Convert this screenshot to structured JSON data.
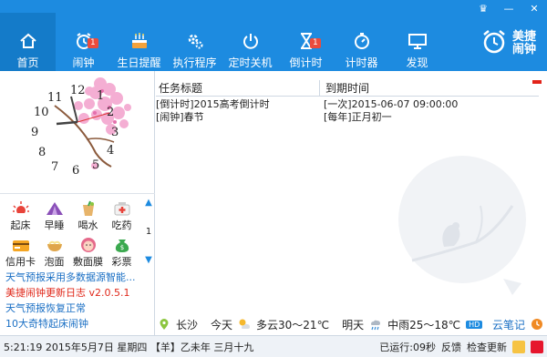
{
  "window": {
    "minimize_label": "—",
    "close_label": "✕",
    "skin_label": "♛"
  },
  "nav": [
    {
      "label": "首页",
      "icon": "home-icon",
      "active": true,
      "badge": ""
    },
    {
      "label": "闹钟",
      "icon": "alarm-icon",
      "active": false,
      "badge": "1"
    },
    {
      "label": "生日提醒",
      "icon": "cake-icon",
      "active": false,
      "badge": ""
    },
    {
      "label": "执行程序",
      "icon": "gears-icon",
      "active": false,
      "badge": ""
    },
    {
      "label": "定时关机",
      "icon": "power-icon",
      "active": false,
      "badge": ""
    },
    {
      "label": "倒计时",
      "icon": "hourglass-icon",
      "active": false,
      "badge": "1"
    },
    {
      "label": "计时器",
      "icon": "stopwatch-icon",
      "active": false,
      "badge": ""
    },
    {
      "label": "发现",
      "icon": "monitor-icon",
      "active": false,
      "badge": ""
    }
  ],
  "brand": {
    "line1": "美捷",
    "line2": "闹钟"
  },
  "clock": {
    "numbers": [
      "12",
      "1",
      "2",
      "3",
      "4",
      "5",
      "6",
      "7",
      "8",
      "9",
      "10",
      "11"
    ]
  },
  "apps": [
    {
      "label": "起床",
      "icon": "sunrise-icon"
    },
    {
      "label": "早睡",
      "icon": "tent-icon"
    },
    {
      "label": "喝水",
      "icon": "drink-icon"
    },
    {
      "label": "吃药",
      "icon": "medicine-icon"
    },
    {
      "label": "信用卡",
      "icon": "credit-card-icon"
    },
    {
      "label": "泡面",
      "icon": "noodle-bowl-icon"
    },
    {
      "label": "敷面膜",
      "icon": "face-mask-icon"
    },
    {
      "label": "彩票",
      "icon": "lottery-bag-icon"
    }
  ],
  "app_page": "1",
  "news": [
    {
      "text": "天气预报采用多数据源智能...",
      "style": "blue"
    },
    {
      "text": "美捷闹钟更新日志",
      "version": "v2.0.5.1",
      "style": "red"
    },
    {
      "text": "天气预报恢复正常",
      "style": "blue"
    },
    {
      "text": "10大奇特起床闹钟",
      "style": "blue"
    }
  ],
  "table": {
    "headers": [
      "任务标题",
      "到期时间"
    ],
    "rows": [
      {
        "title": "[倒计时]2015高考倒计时",
        "due": "[一次]2015-06-07 09:00:00"
      },
      {
        "title": "[闹钟]春节",
        "due": "[每年]正月初一"
      }
    ]
  },
  "weather": {
    "city": "长沙",
    "today_label": "今天",
    "today": "多云30～21℃",
    "tomorrow_label": "明天",
    "tomorrow": "中雨25～18℃",
    "hd_badge": "HD",
    "note": "云笔记"
  },
  "status": {
    "datetime": "5:21:19 2015年5月7日 星期四 【羊】乙未年 三月十九",
    "uptime": "已运行:09秒",
    "feedback": "反馈",
    "update": "检查更新"
  },
  "colors": {
    "topbar": "#1d8be0",
    "active": "#147bc9",
    "badge": "#e94c3d"
  }
}
